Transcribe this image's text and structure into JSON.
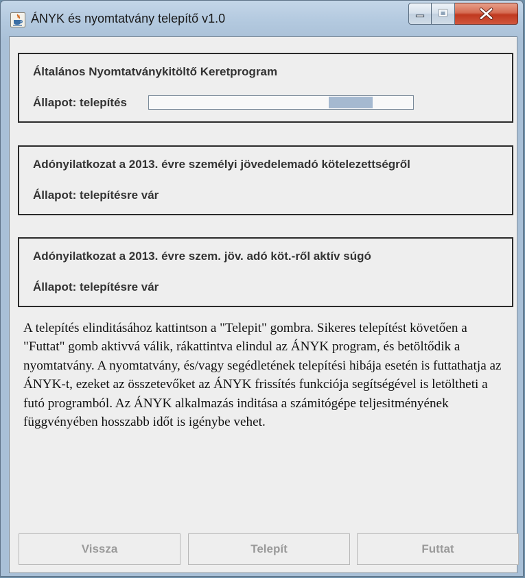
{
  "window": {
    "title": "ÁNYK és nyomtatvány telepítő v1.0"
  },
  "groups": [
    {
      "title": "Általános Nyomtatványkitöltő Keretprogram",
      "status": "Állapot: telepítés",
      "progress": {
        "visible": true,
        "segment_start": 0.68,
        "segment_end": 0.845
      }
    },
    {
      "title": "Adónyilatkozat a 2013. évre személyi jövedelemadó kötelezettségről",
      "status": "Állapot: telepítésre vár"
    },
    {
      "title": "Adónyilatkozat a 2013. évre szem.  jöv.  adó köt.-ről aktív súgó",
      "status": "Állapot: telepítésre vár"
    }
  ],
  "description": "A telepítés elinditásához kattintson a \"Telepit\" gombra. Sikeres telepítést követően a \"Futtat\" gomb aktivvá válik, rákattintva elindul az ÁNYK program, és betöltődik a nyomtatvány. A nyomtatvány, és/vagy segédletének telepítési hibája esetén is futtathatja az ÁNYK-t, ezeket az összetevőket az ÁNYK frissítés funkciója segítségével is letöltheti a futó programból. Az ÁNYK alkalmazás inditása a számitógépe teljesitményének függvényében hosszabb időt is igénybe vehet.",
  "buttons": {
    "back": "Vissza",
    "install": "Telepít",
    "run": "Futtat"
  },
  "colors": {
    "progress_fill": "#a5b9d0",
    "disabled_text": "#9a9a9a",
    "close_button": "#c0391f"
  }
}
